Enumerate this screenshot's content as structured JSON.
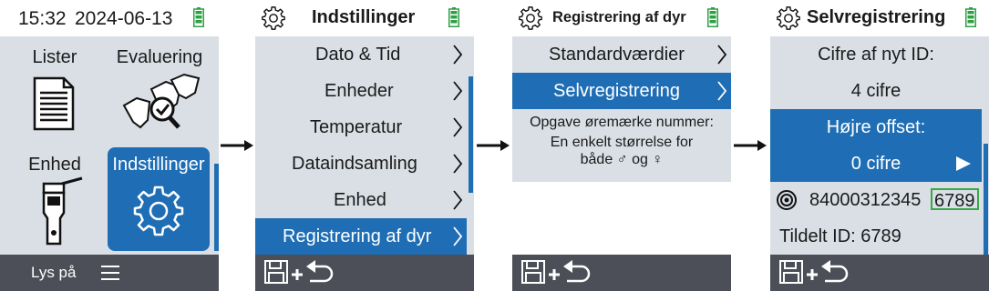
{
  "screen1": {
    "time": "15:32",
    "date": "2024-06-13",
    "tiles": [
      {
        "label": "Lister",
        "icon": "list-document-icon"
      },
      {
        "label": "Evaluering",
        "icon": "cattle-evaluation-icon"
      },
      {
        "label": "Enhed",
        "icon": "handheld-reader-icon"
      },
      {
        "label": "Indstillinger",
        "icon": "gear-icon"
      }
    ],
    "footer": {
      "light_label": "Lys på",
      "menu_icon": "hamburger-menu-icon"
    }
  },
  "screen2": {
    "title": "Indstillinger",
    "items": [
      {
        "label": "Dato & Tid"
      },
      {
        "label": "Enheder"
      },
      {
        "label": "Temperatur"
      },
      {
        "label": "Dataindsamling"
      },
      {
        "label": "Enhed"
      },
      {
        "label": "Registrering af dyr"
      }
    ],
    "selected_index": 5
  },
  "screen3": {
    "title": "Registrering af dyr",
    "items": [
      {
        "label": "Standardværdier"
      },
      {
        "label": "Selvregistrering"
      }
    ],
    "selected_index": 1,
    "info_lines": [
      "Opgave øremærke nummer:",
      "En enkelt størrelse for",
      "både ♂ og ♀"
    ]
  },
  "screen4": {
    "title": "Selvregistrering",
    "digits_label": "Cifre af nyt ID:",
    "digits_value": "4 cifre",
    "offset_label": "Højre offset:",
    "offset_value": "0 cifre",
    "tag_prefix": "84000312345",
    "tag_highlight": "6789",
    "assigned": "Tildelt ID: 6789"
  },
  "footer_icons": [
    "save-icon",
    "plus-icon",
    "back-arrow-icon"
  ],
  "colors": {
    "accent": "#1f6eb5",
    "panel": "#d9dfe5",
    "footer": "#4c4f57",
    "battery": "#2ea043",
    "highlight_box": "#3aa84a"
  }
}
